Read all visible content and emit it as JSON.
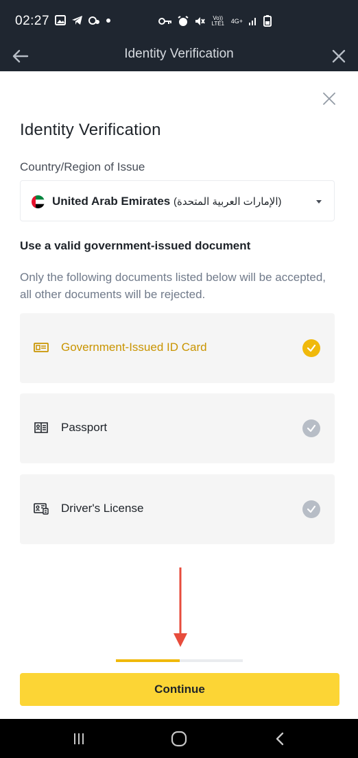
{
  "status_bar": {
    "time": "02:27",
    "left_icons": [
      "gallery-icon",
      "telegram-icon",
      "notification-icon",
      "dot-icon"
    ],
    "right_icons": [
      "vpn-key-icon",
      "alarm-icon",
      "mute-icon",
      "volte-icon",
      "4g-icon",
      "signal-icon",
      "battery-icon"
    ],
    "volte_label": "Vo)) LTE1",
    "network_label": "4G+"
  },
  "header": {
    "title": "Identity Verification"
  },
  "modal": {
    "title": "Identity Verification",
    "country_label": "Country/Region of Issue",
    "country_value": "United Arab Emirates",
    "country_native": "(الإمارات العربية المتحدة)",
    "documents_heading": "Use a valid government-issued document",
    "documents_note": "Only the following documents listed below will be accepted, all other documents will be rejected.",
    "documents": [
      {
        "label": "Government-Issued ID Card",
        "icon": "id-card-icon",
        "selected": true
      },
      {
        "label": "Passport",
        "icon": "passport-icon",
        "selected": false
      },
      {
        "label": "Driver's License",
        "icon": "drivers-license-icon",
        "selected": false
      }
    ],
    "progress": 0.5,
    "continue_label": "Continue"
  },
  "colors": {
    "accent": "#f0b90b",
    "button": "#fcd535",
    "selected_text": "#c99400",
    "header_bg": "#1f2630",
    "check_inactive": "#b7bdc6",
    "annotation_arrow": "#e74c3c"
  },
  "nav_bar": {
    "buttons": [
      "recents-icon",
      "home-icon",
      "back-icon"
    ]
  }
}
